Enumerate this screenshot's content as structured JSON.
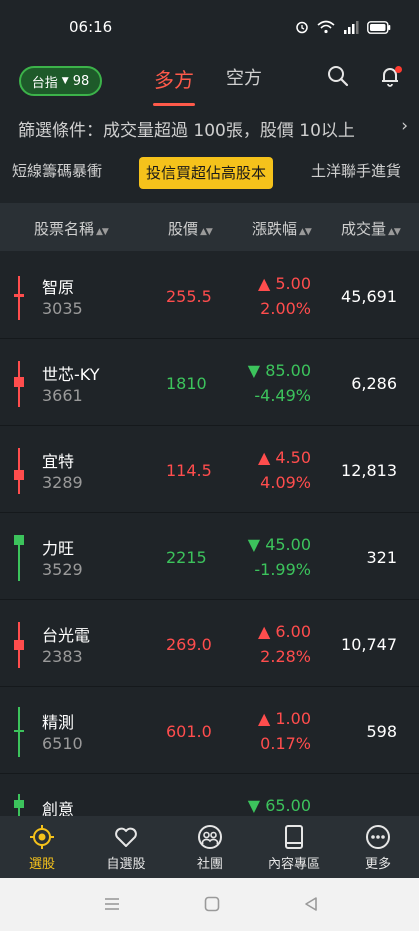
{
  "status": {
    "time": "06:16"
  },
  "topnav": {
    "index_label": "台指",
    "index_value": "98",
    "tab_long": "多方",
    "tab_short": "空方"
  },
  "filter": {
    "text": "篩選條件：成交量超過 100張，股價 10以上"
  },
  "strategies": [
    "短線籌碼暴衝",
    "投信買超佔高股本",
    "土洋聯手進貨"
  ],
  "columns": {
    "name": "股票名稱",
    "price": "股價",
    "change": "漲跌幅",
    "volume": "成交量"
  },
  "rows": [
    {
      "name": "智原",
      "code": "3035",
      "price": "255.5",
      "change": "▲ 5.00",
      "pct": "2.00%",
      "volume": "45,691",
      "dir": "up"
    },
    {
      "name": "世芯-KY",
      "code": "3661",
      "price": "1810",
      "change": "▼ 85.00",
      "pct": "-4.49%",
      "volume": "6,286",
      "dir": "down"
    },
    {
      "name": "宜特",
      "code": "3289",
      "price": "114.5",
      "change": "▲ 4.50",
      "pct": "4.09%",
      "volume": "12,813",
      "dir": "up"
    },
    {
      "name": "力旺",
      "code": "3529",
      "price": "2215",
      "change": "▼ 45.00",
      "pct": "-1.99%",
      "volume": "321",
      "dir": "down"
    },
    {
      "name": "台光電",
      "code": "2383",
      "price": "269.0",
      "change": "▲ 6.00",
      "pct": "2.28%",
      "volume": "10,747",
      "dir": "up"
    },
    {
      "name": "精測",
      "code": "6510",
      "price": "601.0",
      "change": "▲ 1.00",
      "pct": "0.17%",
      "volume": "598",
      "dir": "up"
    },
    {
      "name": "創意",
      "code": "",
      "price": "",
      "change": "▼ 65.00",
      "pct": "",
      "volume": "",
      "dir": "down"
    }
  ],
  "bottomnav": [
    "選股",
    "自選股",
    "社團",
    "內容專區",
    "更多"
  ],
  "colors": {
    "up": "#ff4d4d",
    "down": "#3cc35c",
    "accent": "#f5c21b",
    "bg": "#1f2428"
  }
}
